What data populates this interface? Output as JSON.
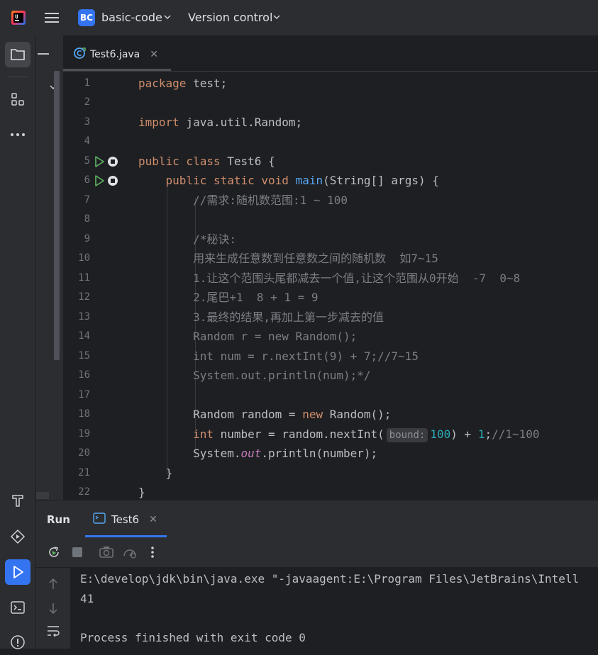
{
  "titlebar": {
    "project_badge": "BC",
    "project_name": "basic-code",
    "vcs_label": "Version control"
  },
  "editor_tab": {
    "label": "Test6.java"
  },
  "code_lines": [
    {
      "n": "1"
    },
    {
      "n": "2"
    },
    {
      "n": "3"
    },
    {
      "n": "4"
    },
    {
      "n": "5"
    },
    {
      "n": "6"
    },
    {
      "n": "7"
    },
    {
      "n": "8"
    },
    {
      "n": "9"
    },
    {
      "n": "10"
    },
    {
      "n": "11"
    },
    {
      "n": "12"
    },
    {
      "n": "13"
    },
    {
      "n": "14"
    },
    {
      "n": "15"
    },
    {
      "n": "16"
    },
    {
      "n": "17"
    },
    {
      "n": "18"
    },
    {
      "n": "19"
    },
    {
      "n": "20"
    },
    {
      "n": "21"
    },
    {
      "n": "22"
    }
  ],
  "code": {
    "l1_kw": "package",
    "l1_rest": " test;",
    "l3_kw": "import",
    "l3_rest": " java.util.Random;",
    "l5_kw": "public class",
    "l5_rest": " Test6 {",
    "l6_kw": "public static void",
    "l6_fn": "main",
    "l6_rest": "(String[] args) {",
    "l7": "//需求:随机数范围:1 ~ 100",
    "l9": "/*秘诀:",
    "l10": "用来生成任意数到任意数之间的随机数  如7~15",
    "l11": "1.让这个范围头尾都减去一个值,让这个范围从0开始  -7  0~8",
    "l12": "2.尾巴+1  8 + 1 = 9",
    "l13": "3.最终的结果,再加上第一步减去的值",
    "l14": "Random r = new Random();",
    "l15": "int num = r.nextInt(9) + 7;//7~15",
    "l16": "System.out.println(num);*/",
    "l18_a": "Random random = ",
    "l18_kw": "new",
    "l18_b": " Random();",
    "l19_kw": "int",
    "l19_a": " number = random.nextInt(",
    "l19_hint": "bound:",
    "l19_num": "100",
    "l19_b": ") + ",
    "l19_num2": "1",
    "l19_c": ";",
    "l19_cm": "//1~100",
    "l20_a": "System.",
    "l20_field": "out",
    "l20_b": ".println(number);",
    "l21": "}",
    "l22": "}"
  },
  "run": {
    "title": "Run",
    "tab_label": "Test6"
  },
  "console": {
    "line1": "E:\\develop\\jdk\\bin\\java.exe \"-javaagent:E:\\Program Files\\JetBrains\\Intell",
    "line2": "41",
    "line3": "Process finished with exit code 0"
  },
  "colors": {
    "accent": "#3574f0",
    "keyword": "#cf8e6d",
    "function": "#56a8f5",
    "comment": "#7a7e85",
    "number": "#2aacb8",
    "run_green": "#5fb865"
  }
}
